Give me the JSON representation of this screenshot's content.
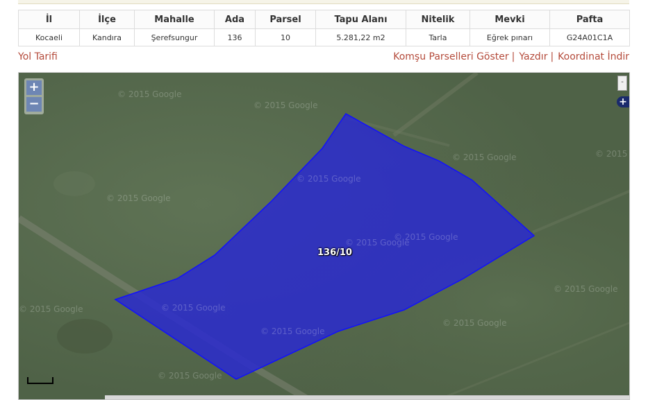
{
  "table": {
    "headers": [
      "İl",
      "İlçe",
      "Mahalle",
      "Ada",
      "Parsel",
      "Tapu Alanı",
      "Nitelik",
      "Mevki",
      "Pafta"
    ],
    "row": [
      "Kocaeli",
      "Kandıra",
      "Şerefsungur",
      "136",
      "10",
      "5.281,22 m2",
      "Tarla",
      "Eğrek pınarı",
      "G24A01C1A"
    ]
  },
  "links": {
    "directions": "Yol Tarifi",
    "neighbors": "Komşu Parselleri Göster",
    "print": "Yazdır",
    "download_coords": "Koordinat İndir",
    "separator": "|"
  },
  "map": {
    "zoom_in": "+",
    "zoom_out": "−",
    "layer_toggle": "-",
    "layer_expand": "+",
    "parcel_label": "136/10",
    "watermark": "© 2015 Google",
    "parcel_fill": "#2a2acf",
    "parcel_stroke": "#1010ff"
  }
}
